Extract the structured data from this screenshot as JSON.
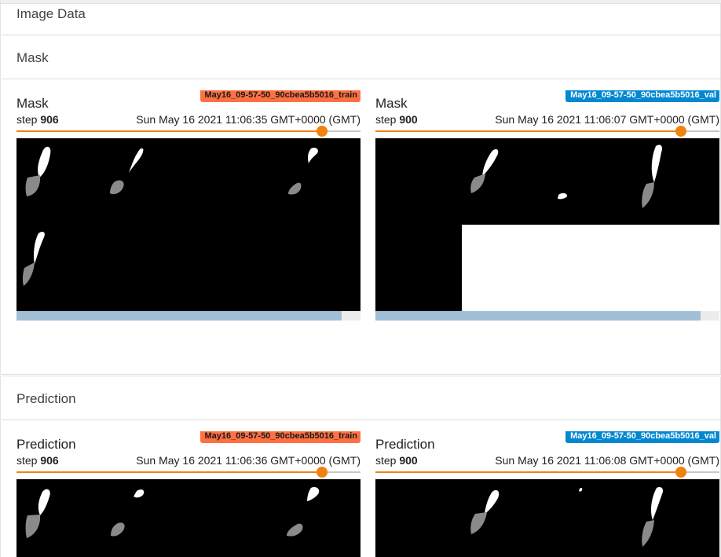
{
  "panel_title": "Image Data",
  "sections": [
    {
      "title": "Mask",
      "cards": [
        {
          "title": "Mask",
          "step_label": "step",
          "step": "906",
          "time": "Sun May 16 2021 11:06:35 GMT+0000 (GMT)",
          "run": "May16_09-57-50_90cbea5b5016_train",
          "run_color": "#ff7043"
        },
        {
          "title": "Mask",
          "step_label": "step",
          "step": "900",
          "time": "Sun May 16 2021 11:06:07 GMT+0000 (GMT)",
          "run": "May16_09-57-50_90cbea5b5016_val",
          "run_color": "#0288d1"
        }
      ]
    },
    {
      "title": "Prediction",
      "cards": [
        {
          "title": "Prediction",
          "step_label": "step",
          "step": "906",
          "time": "Sun May 16 2021 11:06:36 GMT+0000 (GMT)",
          "run": "May16_09-57-50_90cbea5b5016_train",
          "run_color": "#ff7043"
        },
        {
          "title": "Prediction",
          "step_label": "step",
          "step": "900",
          "time": "Sun May 16 2021 11:06:08 GMT+0000 (GMT)",
          "run": "May16_09-57-50_90cbea5b5016_val",
          "run_color": "#0288d1"
        }
      ]
    }
  ],
  "colors": {
    "accent": "#f0820f",
    "train_run": "#ff7043",
    "val_run": "#0288d1",
    "scroll_thumb": "#a3bfd5"
  }
}
